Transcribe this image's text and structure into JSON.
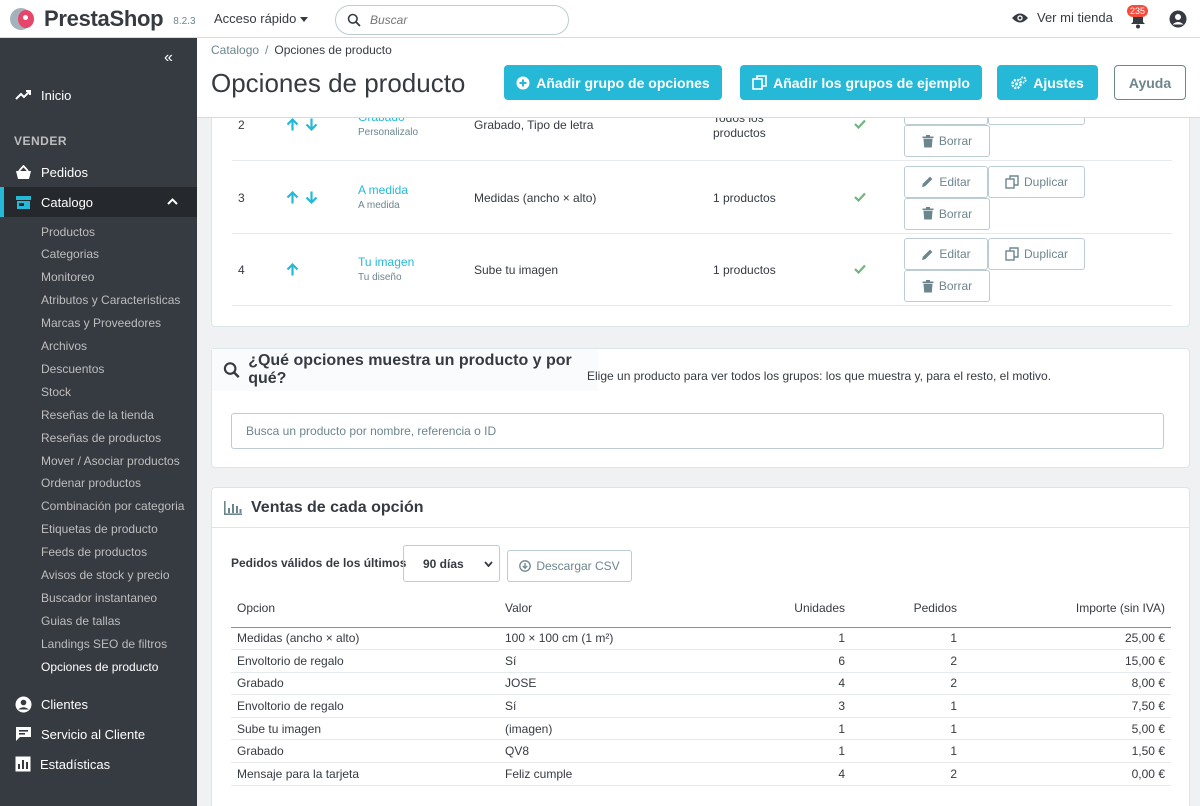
{
  "header": {
    "brand": "PrestaShop",
    "version": "8.2.3",
    "quick_access": "Acceso rápido",
    "search_placeholder": "Buscar",
    "view_shop": "Ver mi tienda",
    "notifications": "235"
  },
  "sidebar": {
    "home": "Inicio",
    "section": "VENDER",
    "orders": "Pedidos",
    "catalog": "Catalogo",
    "catalog_items": [
      "Productos",
      "Categorias",
      "Monitoreo",
      "Atributos y Caracteristicas",
      "Marcas y Proveedores",
      "Archivos",
      "Descuentos",
      "Stock",
      "Reseñas de la tienda",
      "Reseñas de productos",
      "Mover / Asociar productos",
      "Ordenar productos",
      "Combinación por categoria",
      "Etiquetas de producto",
      "Feeds de productos",
      "Avisos de stock y precio",
      "Buscador instantaneo",
      "Guias de tallas",
      "Landings SEO de filtros",
      "Opciones de producto"
    ],
    "customers": "Clientes",
    "support": "Servicio al Cliente",
    "stats": "Estadísticas"
  },
  "page": {
    "breadcrumb_parent": "Catalogo",
    "breadcrumb_sep": "/",
    "breadcrumb_current": "Opciones de producto",
    "title": "Opciones de producto",
    "btn_add_group": "Añadir grupo de opciones",
    "btn_add_examples": "Añadir los grupos de ejemplo",
    "btn_settings": "Ajustes",
    "btn_help": "Ayuda"
  },
  "groups": {
    "edit": "Editar",
    "duplicate": "Duplicar",
    "delete": "Borrar",
    "rows": [
      {
        "idx": "2",
        "name": "Grabado",
        "public": "Personalizalo",
        "values": "Grabado, Tipo de letra",
        "products": "Todos los productos"
      },
      {
        "idx": "3",
        "name": "A medida",
        "public": "A medida",
        "values": "Medidas (ancho × alto)",
        "products": "1 productos"
      },
      {
        "idx": "4",
        "name": "Tu imagen",
        "public": "Tu diseño",
        "values": "Sube tu imagen",
        "products": "1 productos"
      }
    ]
  },
  "which": {
    "title": "¿Qué opciones muestra un producto y por qué?",
    "help": "Elige un producto para ver todos los grupos: los que muestra y, para el resto, el motivo.",
    "placeholder": "Busca un producto por nombre, referencia o ID"
  },
  "sales": {
    "title": "Ventas de cada opción",
    "period_label": "Pedidos válidos de los últimos",
    "period_value": "90 días",
    "csv": "Descargar CSV",
    "columns": [
      "Opcion",
      "Valor",
      "Unidades",
      "Pedidos",
      "Importe (sin IVA)"
    ],
    "rows": [
      [
        "Medidas (ancho × alto)",
        "100 × 100 cm (1 m²)",
        "1",
        "1",
        "25,00 €"
      ],
      [
        "Envoltorio de regalo",
        "Sí",
        "6",
        "2",
        "15,00 €"
      ],
      [
        "Grabado",
        "JOSE",
        "4",
        "2",
        "8,00 €"
      ],
      [
        "Envoltorio de regalo",
        "Sí",
        "3",
        "1",
        "7,50 €"
      ],
      [
        "Sube tu imagen",
        "(imagen)",
        "1",
        "1",
        "5,00 €"
      ],
      [
        "Grabado",
        "QV8",
        "1",
        "1",
        "1,50 €"
      ],
      [
        "Mensaje para la tarjeta",
        "Feliz cumple",
        "4",
        "2",
        "0,00 €"
      ]
    ]
  }
}
